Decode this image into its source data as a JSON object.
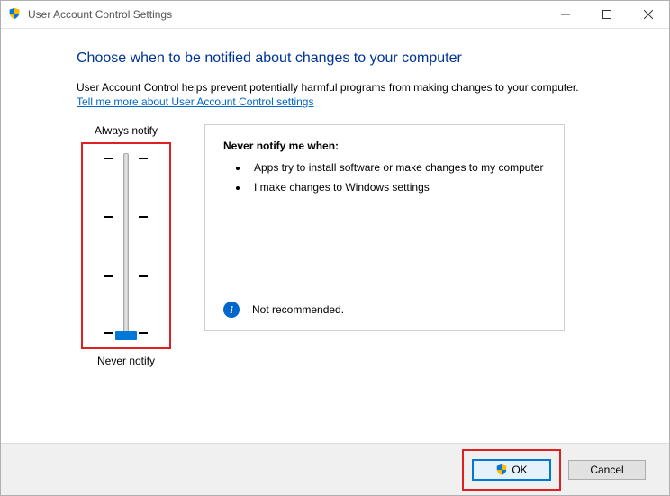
{
  "titlebar": {
    "text": "User Account Control Settings"
  },
  "content": {
    "heading": "Choose when to be notified about changes to your computer",
    "intro": "User Account Control helps prevent potentially harmful programs from making changes to your computer.",
    "link": "Tell me more about User Account Control settings"
  },
  "slider": {
    "top_label": "Always notify",
    "bottom_label": "Never notify"
  },
  "description": {
    "title": "Never notify me when:",
    "items": [
      "Apps try to install software or make changes to my computer",
      "I make changes to Windows settings"
    ],
    "recommendation": "Not recommended."
  },
  "buttons": {
    "ok": "OK",
    "cancel": "Cancel"
  }
}
